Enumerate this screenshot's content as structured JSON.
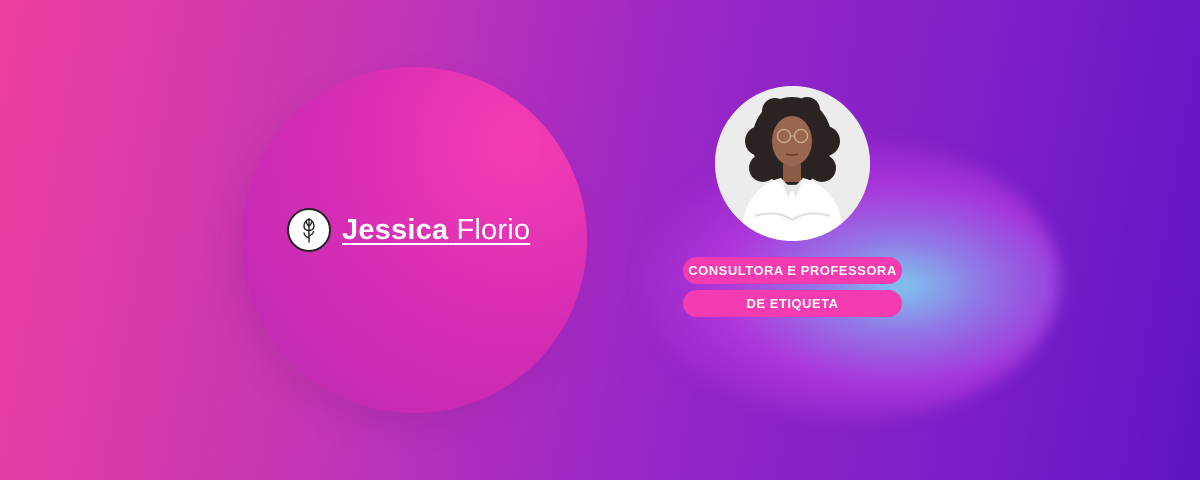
{
  "logo": {
    "first_name": "Jessica",
    "last_name": "Florio",
    "icon": "tulip-icon"
  },
  "profile": {
    "photo": "portrait-photo"
  },
  "title": {
    "line1": "CONSULTORA E PROFESSORA",
    "line2": "DE ETIQUETA"
  },
  "colors": {
    "background_start": "#ec3f9f",
    "background_end": "#5f14c2",
    "circle": "#d82db5",
    "pill": "#f53bb0",
    "glow": "#7dd2f0",
    "text": "#ffffff"
  }
}
